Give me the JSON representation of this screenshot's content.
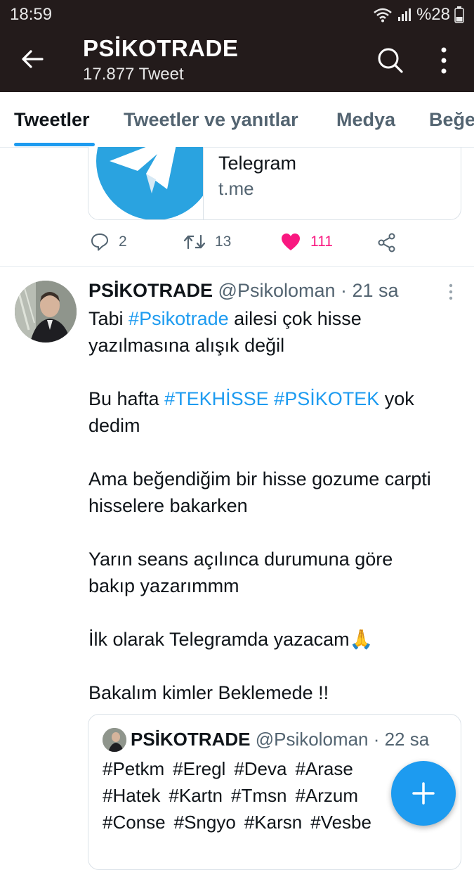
{
  "status_bar": {
    "time": "18:59",
    "battery": "%28"
  },
  "header": {
    "title": "PSİKOTRADE",
    "subtitle": "17.877 Tweet"
  },
  "tabs": [
    {
      "label": "Tweetler",
      "active": true
    },
    {
      "label": "Tweetler ve yanıtlar",
      "active": false
    },
    {
      "label": "Medya",
      "active": false
    },
    {
      "label": "Beğe",
      "active": false
    }
  ],
  "link_card": {
    "name": "Telegram",
    "domain": "t.me"
  },
  "actions": {
    "replies": "2",
    "retweets": "13",
    "likes": "111"
  },
  "tweet": {
    "name": "PSİKOTRADE",
    "meta": "@Psikoloman · 21 sa",
    "line1_prefix": "Tabi ",
    "line1_hashtag": "#Psikotrade",
    "line1_suffix": " ailesi çok hisse",
    "line2": "yazılmasına alışık değil",
    "line3_prefix": "Bu hafta ",
    "line3_hashtag1": "#TEKHİSSE",
    "line3_hashtag2": "#PSİKOTEK",
    "line3_suffix": "  yok",
    "line4": "dedim",
    "line5": "Ama beğendiğim bir hisse gozume carpti",
    "line6": "hisselere bakarken",
    "line7": "Yarın seans açılınca durumuna göre",
    "line8": "bakıp yazarımmm",
    "line9": "İlk olarak Telegramda yazacam🙏",
    "line10": "Bakalım kimler Beklemede !!"
  },
  "quote": {
    "name": "PSİKOTRADE",
    "meta": "@Psikoloman · 22 sa",
    "row1": [
      "#Petkm",
      "#Eregl",
      "#Deva",
      "#Arase"
    ],
    "row2": [
      "#Hatek",
      "#Kartn",
      "#Tmsn",
      "#Arzum"
    ],
    "row3": [
      "#Conse",
      "#Sngyo",
      "#Karsn",
      "#Vesbe"
    ]
  },
  "colors": {
    "accent": "#1d9bf0",
    "like": "#f91880",
    "header_bg": "#231b1b"
  },
  "icons": [
    "back-arrow-icon",
    "search-icon",
    "more-vert-icon",
    "reply-icon",
    "retweet-icon",
    "heart-icon",
    "share-icon",
    "compose-plus-icon"
  ]
}
